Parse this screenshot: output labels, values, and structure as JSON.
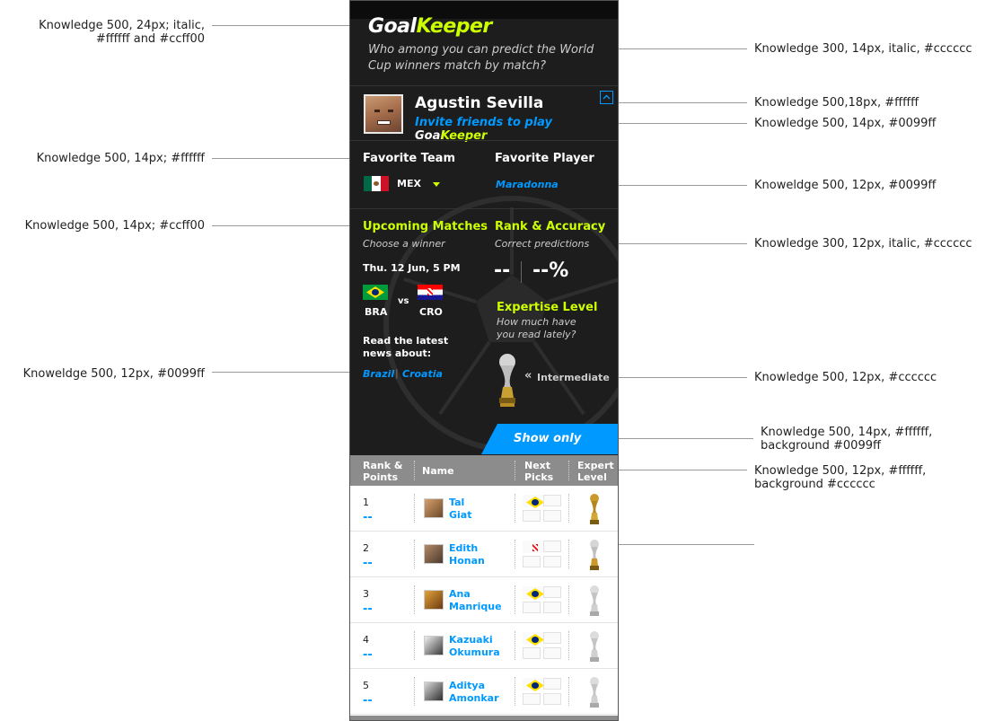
{
  "annotations": {
    "logo_left_1": "Knowledge  500, 24px; italic,",
    "logo_left_2": "#ffffff and #ccff00",
    "team_left": "Knowledge  500, 14px; #ffffff",
    "upcoming_left": "Knowledge 500, 14px; #ccff00",
    "news_left": "Knoweldge 500, 12px, #0099ff",
    "tagline_right": "Knowledge  300, 14px, italic, #cccccc",
    "name_right": "Knowledge  500,18px, #ffffff",
    "invite_right": "Knowledge  500, 14px, #0099ff",
    "player_right": "Knoweldge 500, 12px, #0099ff",
    "correct_right": "Knowledge 300, 12px, italic, #cccccc",
    "intermediate_right": "Knowledge 500, 12px, #cccccc",
    "friends_right_1": "Knowledge  500, 14px, #ffffff,",
    "friends_right_2": "background #0099ff",
    "header_right_1": "Knowledge  500, 12px, #ffffff,",
    "header_right_2": "background #cccccc"
  },
  "app": {
    "brand_a": "Goal",
    "brand_b": "Keeper",
    "tagline": "Who among you can predict the World Cup winners match by match?"
  },
  "user": {
    "name": "Agustin Sevilla",
    "invite_text": "Invite friends to play",
    "invite_brand_a": "Goal",
    "invite_brand_b": "Keeper",
    "collapse_icon": "chevron-up-icon"
  },
  "favorites": {
    "team_label": "Favorite Team",
    "team_code": "MEX",
    "player_label": "Favorite Player",
    "player_name": "Maradonna"
  },
  "upcoming": {
    "title": "Upcoming Matches",
    "subtitle": "Choose a winner",
    "date": "Thu. 12 Jun, 5 PM",
    "home": "BRA",
    "vs": "vs",
    "away": "CRO",
    "news_title": "Read the latest news about:",
    "news_link_1": "Brazil",
    "news_sep": "|",
    "news_link_2": "Croatia"
  },
  "rank": {
    "title": "Rank & Accuracy",
    "subtitle": "Correct predictions",
    "rank_value": "--",
    "accuracy_value": "--%",
    "expertise_title": "Expertise Level",
    "expertise_sub": "How much have you read lately?",
    "level_arrow": "«",
    "level": "Intermediate"
  },
  "friends_button": "Show only Friends",
  "table": {
    "headers": [
      "Rank & Points",
      "Name",
      "Next Picks",
      "Expert Level"
    ],
    "rows": [
      {
        "rank": "1",
        "points": "--",
        "first": "Tal",
        "last": "Giat",
        "pick": "BRA",
        "level": "gold"
      },
      {
        "rank": "2",
        "points": "--",
        "first": "Edith",
        "last": "Honan",
        "pick": "CRO",
        "level": "silver-gold"
      },
      {
        "rank": "3",
        "points": "--",
        "first": "Ana",
        "last": "Manrique",
        "pick": "BRA",
        "level": "silver"
      },
      {
        "rank": "4",
        "points": "--",
        "first": "Kazuaki",
        "last": "Okumura",
        "pick": "BRA",
        "level": "silver"
      },
      {
        "rank": "5",
        "points": "--",
        "first": "Aditya",
        "last": "Amonkar",
        "pick": "BRA",
        "level": "silver"
      }
    ]
  },
  "colors": {
    "accent_blue": "#0099ff",
    "accent_green": "#ccff00",
    "muted": "#cccccc",
    "header_gray": "#8c8c8c"
  }
}
